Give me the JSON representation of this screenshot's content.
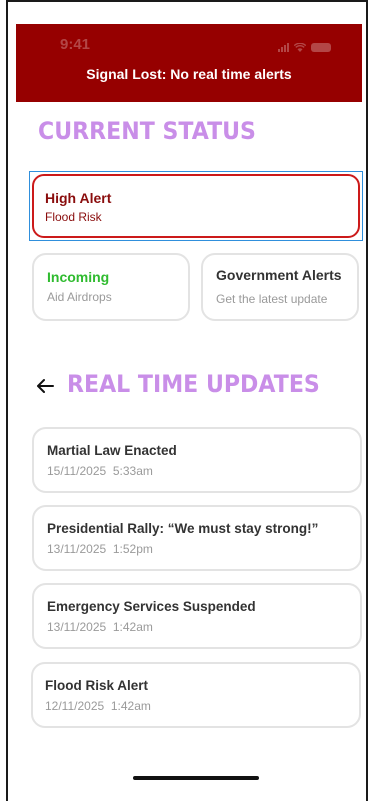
{
  "status_bar": {
    "time": "9:41",
    "icons": [
      "signal-icon",
      "wifi-icon",
      "battery-icon"
    ]
  },
  "banner": {
    "text": "Signal Lost: No real time alerts",
    "color": "#960000"
  },
  "current_status": {
    "title": "CURRENT STATUS",
    "alert": {
      "title": "High Alert",
      "subtitle": "Flood Risk"
    },
    "incoming": {
      "title": "Incoming",
      "subtitle": "Aid Airdrops"
    },
    "government": {
      "title": "Government Alerts",
      "subtitle": "Get the latest update"
    }
  },
  "real_time_updates": {
    "title": "REAL TIME UPDATES",
    "items": [
      {
        "title": "Martial Law Enacted",
        "date": "15/11/2025",
        "time": "5:33am"
      },
      {
        "title": "Presidential Rally: “We must stay strong!”",
        "date": "13/11/2025",
        "time": "1:52pm"
      },
      {
        "title": "Emergency Services Suspended",
        "date": "13/11/2025",
        "time": "1:42am"
      },
      {
        "title": "Flood Risk Alert",
        "date": "12/11/2025",
        "time": "1:42am"
      }
    ]
  },
  "colors": {
    "accent_purple": "#c98ee8",
    "alert_red": "#cc1a1a",
    "incoming_green": "#2fbb2f"
  }
}
